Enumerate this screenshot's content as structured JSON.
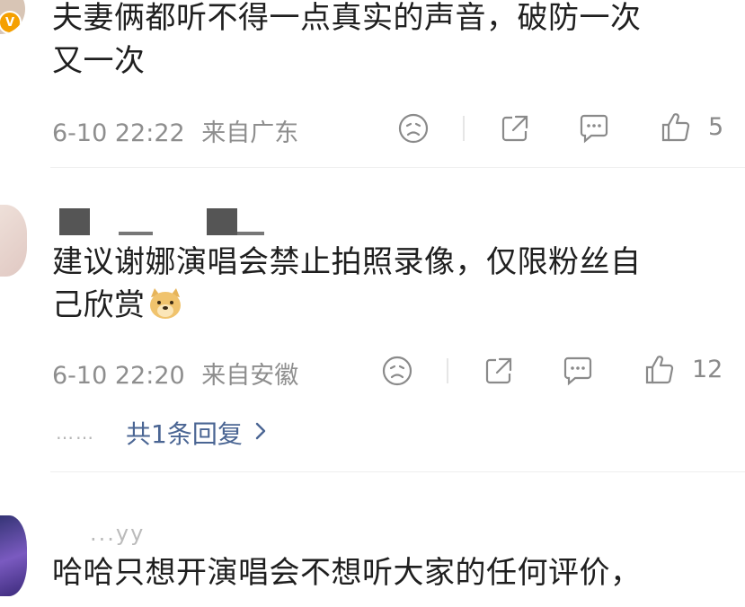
{
  "comments": [
    {
      "lines": [
        "夫妻俩都听不得一点真实的声音，破防一次",
        "又一次"
      ],
      "time": "6-10 22:22",
      "location": "来自广东",
      "likes": "5"
    },
    {
      "lines": [
        "建议谢娜演唱会禁止拍照录像，仅限粉丝自",
        "己欣赏"
      ],
      "time": "6-10 22:20",
      "location": "来自安徽",
      "likes": "12",
      "reply_link": "共1条回复",
      "emoji": "doge-emoji"
    },
    {
      "username_partial": "...yy",
      "lines": [
        "哈哈只想开演唱会不想听大家的任何评价，"
      ]
    }
  ],
  "icons": {
    "reaction": "sad-face-icon",
    "share": "share-icon",
    "comment": "comment-icon",
    "like": "thumbs-up-icon",
    "reply_arrow": "chevron-right-icon"
  },
  "reply_dots": "……",
  "badge_letter": "V"
}
